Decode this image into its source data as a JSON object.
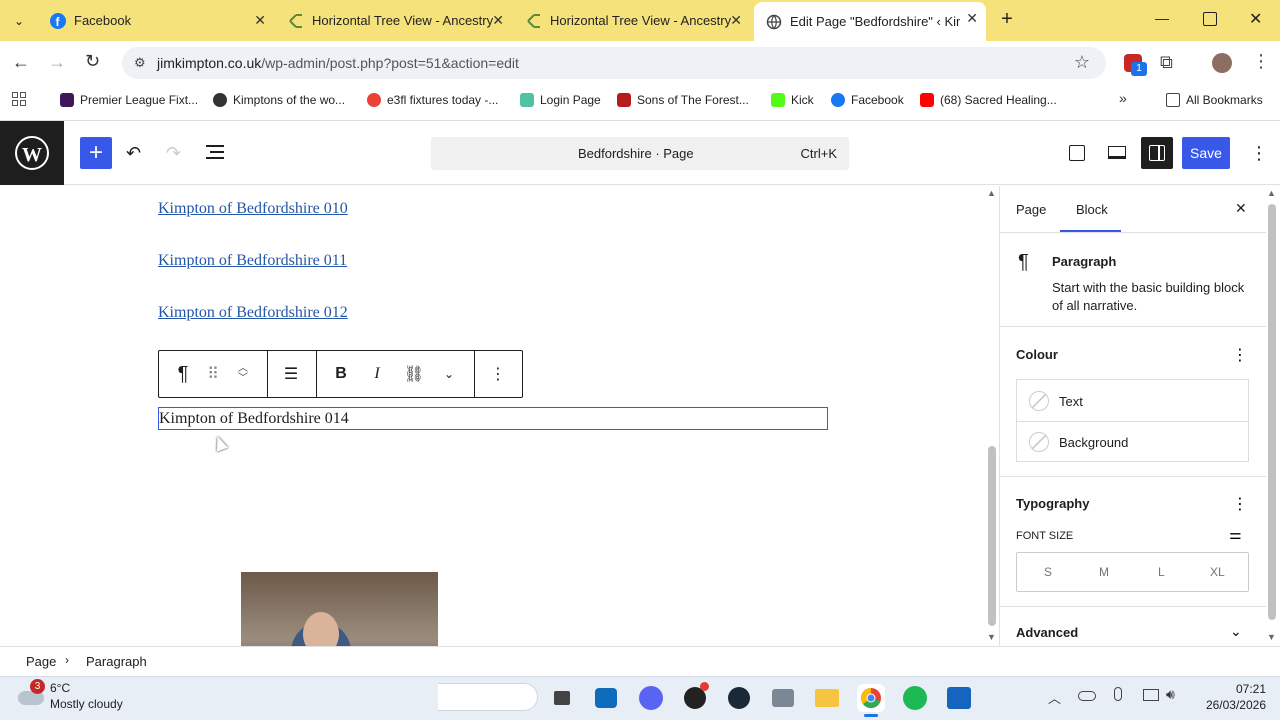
{
  "tabs": [
    {
      "label": "Facebook",
      "icon": "facebook-icon"
    },
    {
      "label": "Horizontal Tree View - Ancestry",
      "icon": "ancestry-icon"
    },
    {
      "label": "Horizontal Tree View - Ancestry",
      "icon": "ancestry-icon"
    },
    {
      "label": "Edit Page \"Bedfordshire\" ‹ Kimp",
      "icon": "globe-icon"
    }
  ],
  "address": {
    "domain": "jimkimpton.co.uk",
    "path": "/wp-admin/post.php?post=51&action=edit"
  },
  "bookmarks": [
    {
      "label": "Premier League Fixt...",
      "color": "#3d195b"
    },
    {
      "label": "Kimptons of the wo...",
      "color": "#333"
    },
    {
      "label": "e3fl fixtures today -...",
      "color": "#ea4335"
    },
    {
      "label": "Login Page",
      "color": "#4fc3a1"
    },
    {
      "label": "Sons of The Forest...",
      "color": "#b71c1c"
    },
    {
      "label": "Kick",
      "color": "#53fc18"
    },
    {
      "label": "Facebook",
      "color": "#1877f2"
    },
    {
      "label": "(68) Sacred Healing...",
      "color": "#ff0000"
    }
  ],
  "all_bookmarks": "All Bookmarks",
  "extension_badge": "1",
  "editor": {
    "command": "Bedfordshire · Page",
    "shortcut": "Ctrl+K",
    "save": "Save",
    "links": [
      "Kimpton of Bedfordshire 010",
      "Kimpton of Bedfordshire 011",
      "Kimpton of Bedfordshire 012"
    ],
    "paragraph": "Kimpton of Bedfordshire 014"
  },
  "sidebar": {
    "tab_page": "Page",
    "tab_block": "Block",
    "block_name": "Paragraph",
    "block_desc": "Start with the basic building block of all narrative.",
    "colour": "Colour",
    "text": "Text",
    "background": "Background",
    "typography": "Typography",
    "font_size": "FONT SIZE",
    "sizes": [
      "S",
      "M",
      "L",
      "XL"
    ],
    "advanced": "Advanced"
  },
  "breadcrumb": {
    "page": "Page",
    "paragraph": "Paragraph"
  },
  "weather": {
    "temp": "6°C",
    "desc": "Mostly cloudy",
    "badge": "3"
  },
  "clock": {
    "time": "07:21",
    "date": "26/03/2026"
  }
}
